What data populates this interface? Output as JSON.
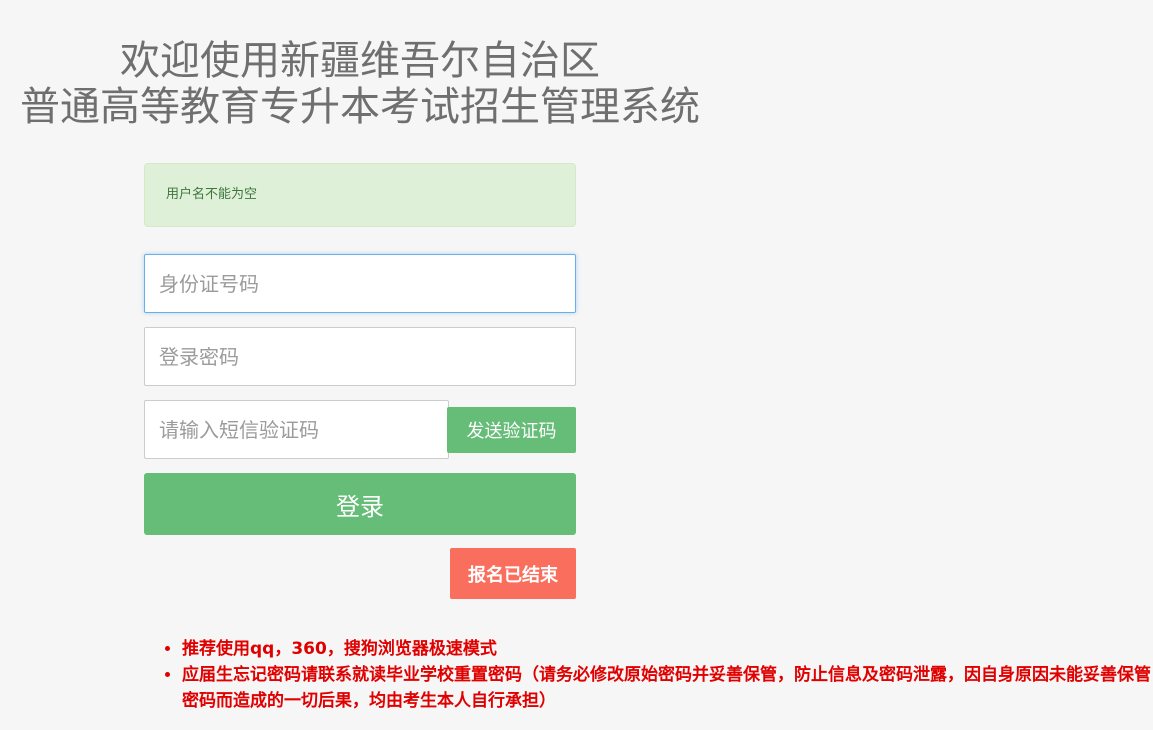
{
  "header": {
    "title_line1": "欢迎使用新疆维吾尔自治区",
    "title_line2": "普通高等教育专升本考试招生管理系统"
  },
  "alert": {
    "message": "用户名不能为空"
  },
  "form": {
    "id_placeholder": "身份证号码",
    "password_placeholder": "登录密码",
    "sms_placeholder": "请输入短信验证码",
    "sms_button_label": "发送验证码",
    "login_button_label": "登录",
    "registration_closed_label": "报名已结束"
  },
  "notes": [
    "推荐使用qq，360，搜狗浏览器极速模式",
    "应届生忘记密码请联系就读毕业学校重置密码（请务必修改原始密码并妥善保管，防止信息及密码泄露，因自身原因未能妥善保管密码而造成的一切后果，均由考生本人自行承担）"
  ],
  "colors": {
    "background": "#f6f6f6",
    "primary_green": "#66bd78",
    "closed_red": "#fa6e5e",
    "alert_bg": "#dff0d8",
    "note_red": "#e00000"
  }
}
